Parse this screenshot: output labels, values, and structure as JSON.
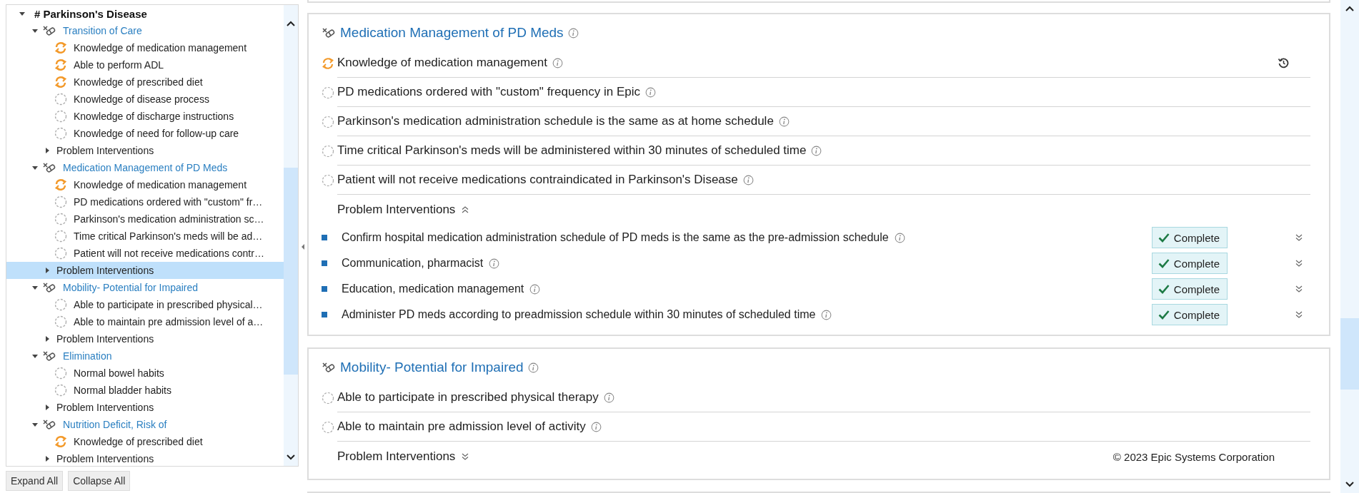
{
  "tree": {
    "title": "# Parkinson's Disease",
    "expanded": true,
    "groups": [
      {
        "label": "Transition of Care",
        "expanded": true,
        "selected": false,
        "children": [
          {
            "label": "Knowledge of medication management",
            "kind": "progress",
            "selected": false
          },
          {
            "label": "Able to perform ADL",
            "kind": "progress",
            "selected": false
          },
          {
            "label": "Knowledge of prescribed diet",
            "kind": "progress",
            "selected": false
          },
          {
            "label": "Knowledge of disease process",
            "kind": "pending",
            "selected": false
          },
          {
            "label": "Knowledge of discharge instructions",
            "kind": "pending",
            "selected": false
          },
          {
            "label": "Knowledge of need for follow-up care",
            "kind": "pending",
            "selected": false
          },
          {
            "label": "Problem Interventions",
            "kind": "interventions",
            "expanded": false,
            "selected": false
          }
        ]
      },
      {
        "label": "Medication Management of PD Meds",
        "expanded": true,
        "selected": false,
        "children": [
          {
            "label": "Knowledge of medication management",
            "kind": "progress",
            "selected": false
          },
          {
            "label": "PD medications ordered with \"custom\" fr…",
            "kind": "pending",
            "selected": false
          },
          {
            "label": "Parkinson's medication administration sc…",
            "kind": "pending",
            "selected": false
          },
          {
            "label": "Time critical Parkinson's meds will be ad…",
            "kind": "pending",
            "selected": false
          },
          {
            "label": "Patient will not receive medications contr…",
            "kind": "pending",
            "selected": false
          },
          {
            "label": "Problem Interventions",
            "kind": "interventions",
            "expanded": false,
            "selected": true
          }
        ]
      },
      {
        "label": "Mobility- Potential for Impaired",
        "expanded": true,
        "selected": false,
        "children": [
          {
            "label": "Able to participate in prescribed physical…",
            "kind": "pending",
            "selected": false
          },
          {
            "label": "Able to maintain pre admission level of a…",
            "kind": "pending",
            "selected": false
          },
          {
            "label": "Problem Interventions",
            "kind": "interventions",
            "expanded": false,
            "selected": false
          }
        ]
      },
      {
        "label": "Elimination",
        "expanded": true,
        "selected": false,
        "children": [
          {
            "label": "Normal bowel habits",
            "kind": "pending",
            "selected": false
          },
          {
            "label": "Normal bladder habits",
            "kind": "pending",
            "selected": false
          },
          {
            "label": "Problem Interventions",
            "kind": "interventions",
            "expanded": false,
            "selected": false
          }
        ]
      },
      {
        "label": "Nutrition Deficit, Risk of",
        "expanded": true,
        "selected": false,
        "children": [
          {
            "label": "Knowledge of prescribed diet",
            "kind": "progress",
            "selected": false
          },
          {
            "label": "Problem Interventions",
            "kind": "interventions",
            "expanded": false,
            "selected": false
          }
        ]
      }
    ]
  },
  "buttons": [
    "Expand All",
    "Collapse All"
  ],
  "cards": [
    {
      "title": "Medication Management of PD Meds",
      "outcomes": [
        {
          "label": "Knowledge of medication management",
          "kind": "progress",
          "history": true
        },
        {
          "label": "PD medications ordered with \"custom\" frequency in Epic",
          "kind": "pending"
        },
        {
          "label": "Parkinson's medication administration schedule is the same as at home schedule",
          "kind": "pending"
        },
        {
          "label": "Time critical Parkinson's meds will be administered within 30 minutes of scheduled time",
          "kind": "pending"
        },
        {
          "label": "Patient will not receive medications contraindicated in Parkinson's Disease",
          "kind": "pending"
        }
      ],
      "interventions": {
        "label": "Problem Interventions",
        "expanded": true,
        "items": [
          {
            "label": "Confirm hospital medication administration schedule of PD meds is the same as the pre-admission schedule",
            "status": "Complete"
          },
          {
            "label": "Communication, pharmacist",
            "status": "Complete"
          },
          {
            "label": "Education, medication management",
            "status": "Complete"
          },
          {
            "label": "Administer PD meds according to preadmission schedule within 30 minutes of scheduled time",
            "status": "Complete"
          }
        ]
      }
    },
    {
      "title": "Mobility- Potential for Impaired",
      "outcomes": [
        {
          "label": "Able to participate in prescribed physical therapy",
          "kind": "pending"
        },
        {
          "label": "Able to maintain pre admission level of activity",
          "kind": "pending"
        }
      ],
      "interventions": {
        "label": "Problem Interventions",
        "expanded": false
      },
      "footer": "© 2023 Epic Systems Corporation"
    }
  ]
}
